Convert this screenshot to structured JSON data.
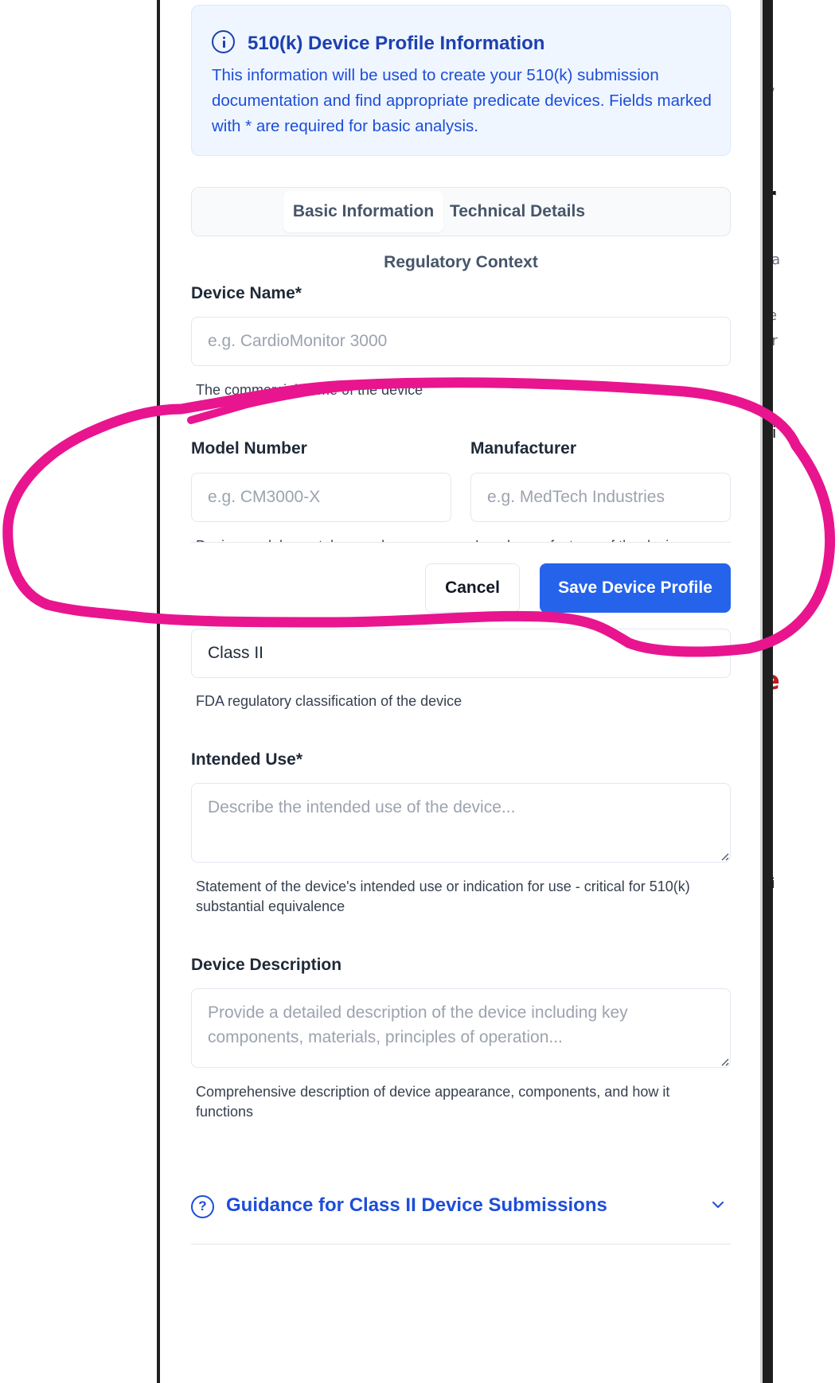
{
  "info": {
    "title": "510(k) Device Profile Information",
    "text": "This information will be used to create your 510(k) submission documentation and find appropriate predicate devices. Fields marked with * are required for basic analysis."
  },
  "tabs": [
    {
      "label": "Basic Information",
      "active": true
    },
    {
      "label": "Technical Details",
      "active": false
    },
    {
      "label": "Regulatory Context",
      "active": false
    }
  ],
  "fields": {
    "device_name": {
      "label": "Device Name*",
      "placeholder": "e.g. CardioMonitor 3000",
      "help": "The commercial name of the device"
    },
    "model_number": {
      "label": "Model Number",
      "placeholder": "e.g. CM3000-X",
      "help": "Device model or catalog number"
    },
    "manufacturer": {
      "label": "Manufacturer",
      "placeholder": "e.g. MedTech Industries",
      "help": "Legal manufacturer of the device"
    },
    "device_class": {
      "value": "Class II",
      "help": "FDA regulatory classification of the device"
    },
    "intended_use": {
      "label": "Intended Use*",
      "placeholder": "Describe the intended use of the device...",
      "help": "Statement of the device's intended use or indication for use - critical for 510(k) substantial equivalence"
    },
    "device_description": {
      "label": "Device Description",
      "placeholder": "Provide a detailed description of the device including key components, materials, principles of operation...",
      "help": "Comprehensive description of device appearance, components, and how it functions"
    }
  },
  "actions": {
    "cancel": "Cancel",
    "save": "Save Device Profile"
  },
  "guidance": {
    "title": "Guidance for Class II Device Submissions"
  },
  "background_fragments": [
    "V",
    "r",
    "ea",
    "re",
    "ur",
    "vi",
    "e",
    "r",
    "s",
    "vi"
  ],
  "colors": {
    "primary": "#2563eb",
    "info_bg": "#eff6ff",
    "info_text": "#1d4ed8",
    "annotation": "#e8158f"
  }
}
